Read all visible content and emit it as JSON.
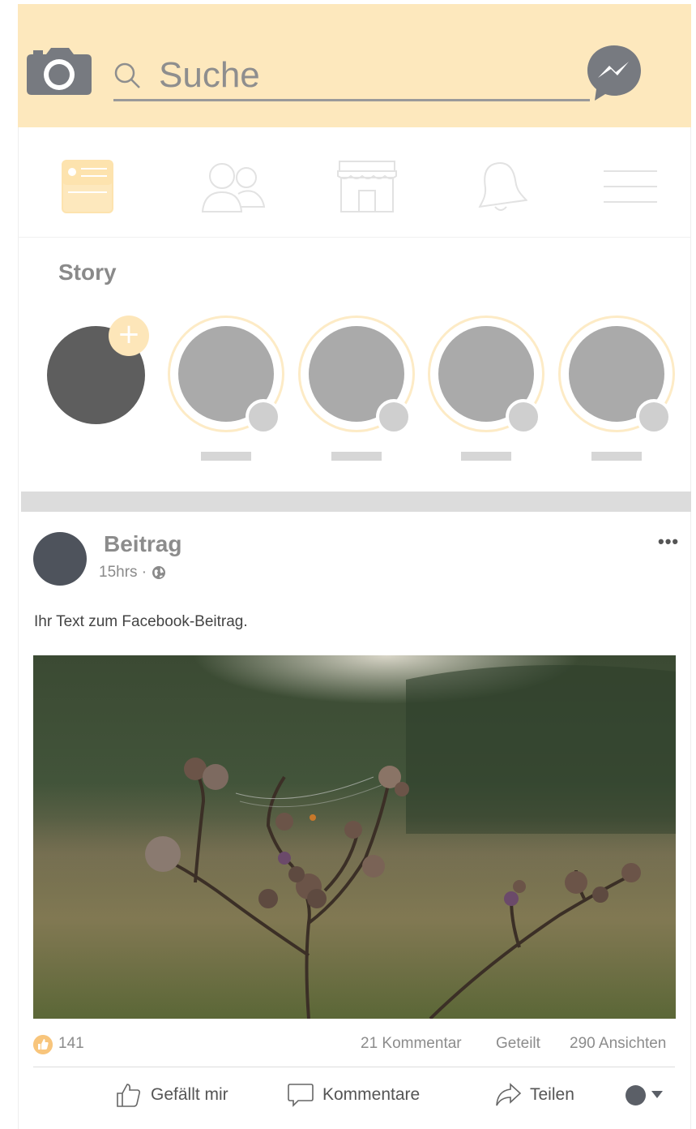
{
  "header": {
    "search_placeholder": "Suche"
  },
  "nav": {
    "items": [
      {
        "icon": "news-feed-icon",
        "active": true
      },
      {
        "icon": "friends-icon",
        "active": false
      },
      {
        "icon": "marketplace-icon",
        "active": false
      },
      {
        "icon": "bell-icon",
        "active": false
      },
      {
        "icon": "menu-icon",
        "active": false
      }
    ]
  },
  "stories": {
    "title": "Story",
    "add_symbol": "+",
    "count": 4
  },
  "post": {
    "title": "Beitrag",
    "time": "15hrs ·",
    "text": "Ihr Text zum Facebook-Beitrag.",
    "more_symbol": "•••",
    "likes": "141",
    "comments": "21 Kommentar",
    "shares": "Geteilt",
    "views": "290 Ansichten"
  },
  "actions": {
    "like": "Gefällt mir",
    "comment": "Kommentare",
    "share": "Teilen"
  },
  "colors": {
    "header_bg": "#fde8bd",
    "accent": "#fde6b9",
    "avatar": "#4e535c"
  }
}
